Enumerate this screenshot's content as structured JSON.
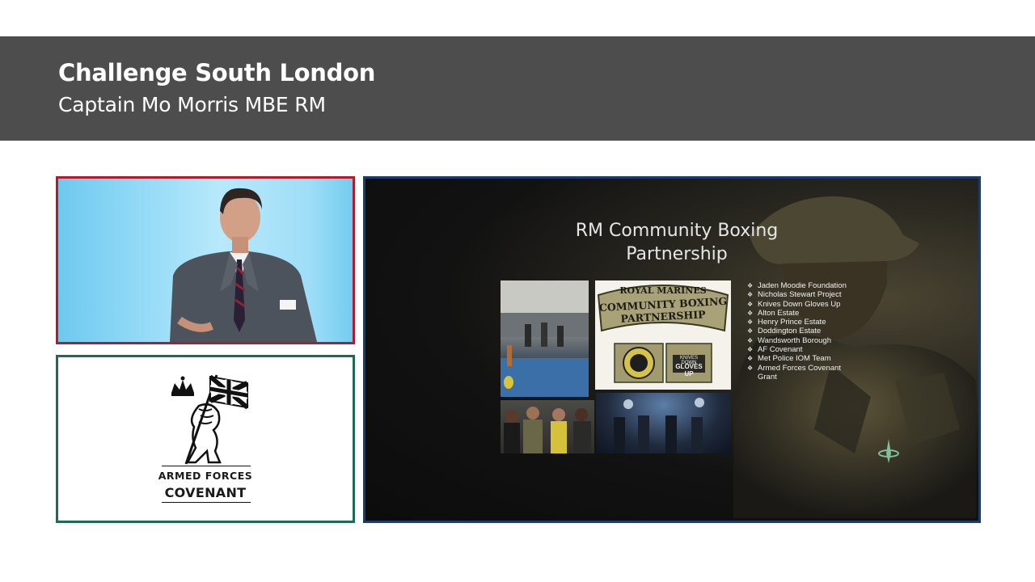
{
  "header": {
    "title": "Challenge South London",
    "subtitle": "Captain Mo Morris MBE RM"
  },
  "covenant": {
    "line1": "ARMED FORCES",
    "line2": "COVENANT"
  },
  "slide": {
    "title_line1": "RM Community Boxing",
    "title_line2": "Partnership",
    "badge": {
      "line1": "ROYAL MARINES",
      "line2": "COMMUNITY BOXING",
      "line3": "PARTNERSHIP",
      "patch_right_line1": "KNIVES DOWN",
      "patch_right_line2": "GLOVES UP"
    },
    "partners": [
      "Jaden Moodie Foundation",
      "Nicholas Stewart Project",
      "Knives Down Gloves Up",
      "Alton Estate",
      "Henry Prince Estate",
      "Doddington Estate",
      "Wandsworth Borough",
      "AF Covenant",
      "Met Police IOM Team",
      "Armed Forces Covenant Grant"
    ]
  },
  "colors": {
    "title_bar": "#4d4d4d",
    "speaker_border": "#b01c2e",
    "covenant_border": "#1d6b57",
    "slide_border": "#1e3a66"
  },
  "icons": {
    "covenant_logo": "lion-with-union-flag-and-crown-icon",
    "corps_emblem": "commando-dagger-icon"
  }
}
